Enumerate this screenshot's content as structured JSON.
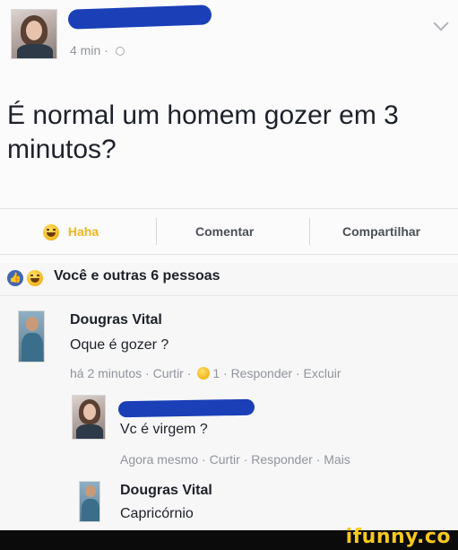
{
  "post": {
    "time": "4 min",
    "time_separator": "·",
    "text": "É normal um homem gozer em 3 minutos?",
    "actions": {
      "react_label": "Haha",
      "comment_label": "Comentar",
      "share_label": "Compartilhar"
    },
    "reactions_summary": "Você e outras 6 pessoas"
  },
  "comments": [
    {
      "author": "Dougras Vital",
      "text": "Oque é gozer ?",
      "meta_time": "há 2 minutos",
      "meta_like": "Curtir",
      "meta_reaction_count": "1",
      "meta_reply": "Responder",
      "meta_extra": "Excluir"
    },
    {
      "author": "",
      "text": "Vc é virgem ?",
      "meta_time": "Agora mesmo",
      "meta_like": "Curtir",
      "meta_reply": "Responder",
      "meta_extra": "Mais"
    },
    {
      "author": "Dougras Vital",
      "text": "Capricórnio"
    }
  ],
  "watermark": "ifunny.co",
  "colors": {
    "haha": "#f2b51c",
    "like_blue": "#4267b2",
    "redaction": "#1a3fb7"
  }
}
